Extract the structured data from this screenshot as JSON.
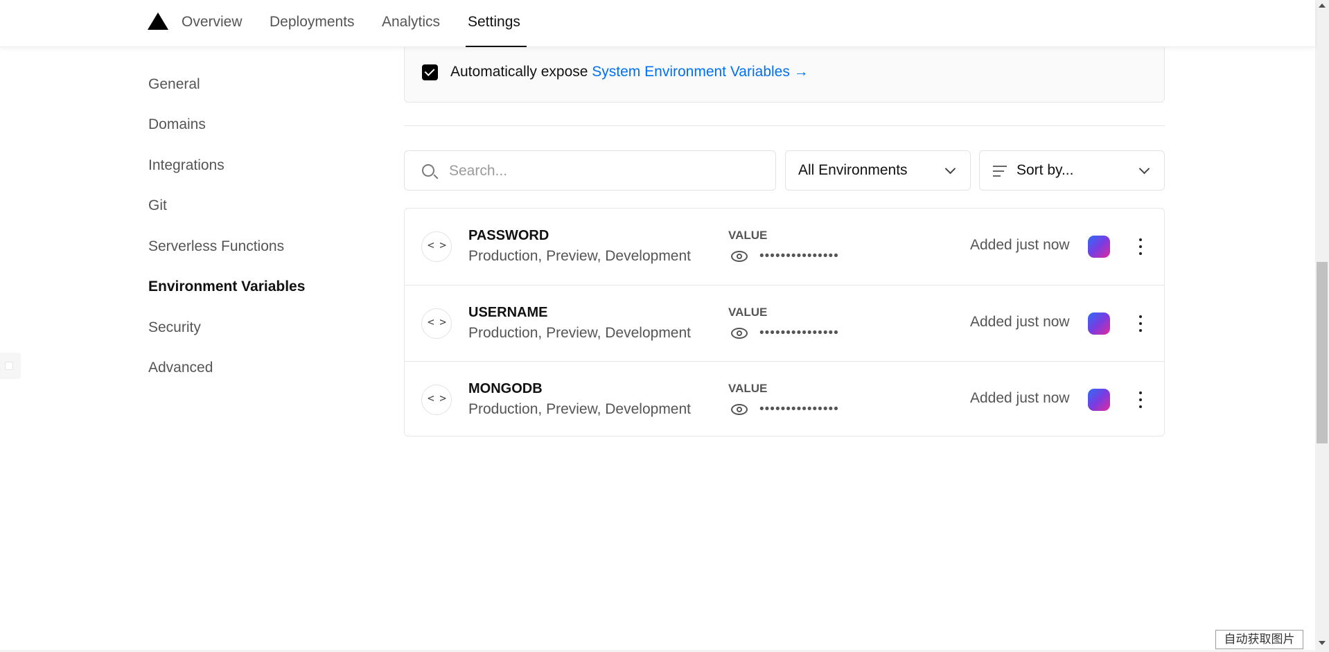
{
  "nav": {
    "tabs": [
      {
        "label": "Overview"
      },
      {
        "label": "Deployments"
      },
      {
        "label": "Analytics"
      },
      {
        "label": "Settings",
        "active": true
      }
    ]
  },
  "sidebar": {
    "items": [
      {
        "label": "General"
      },
      {
        "label": "Domains"
      },
      {
        "label": "Integrations"
      },
      {
        "label": "Git"
      },
      {
        "label": "Serverless Functions"
      },
      {
        "label": "Environment Variables",
        "active": true
      },
      {
        "label": "Security"
      },
      {
        "label": "Advanced"
      }
    ]
  },
  "expose": {
    "checked": true,
    "text": "Automatically expose ",
    "link": "System Environment Variables →"
  },
  "filters": {
    "search_placeholder": "Search...",
    "environment_select": "All Environments",
    "sort_select": "Sort by..."
  },
  "env_vars": [
    {
      "name": "PASSWORD",
      "scope": "Production, Preview, Development",
      "value_label": "VALUE",
      "masked_value": "•••••••••••••••",
      "added": "Added just now"
    },
    {
      "name": "USERNAME",
      "scope": "Production, Preview, Development",
      "value_label": "VALUE",
      "masked_value": "•••••••••••••••",
      "added": "Added just now"
    },
    {
      "name": "MONGODB",
      "scope": "Production, Preview, Development",
      "value_label": "VALUE",
      "masked_value": "•••••••••••••••",
      "added": "Added just now"
    }
  ],
  "bottom_button": "自动获取图片",
  "colors": {
    "accent_link": "#0070f3",
    "avatar_gradient": [
      "#2f6cf6",
      "#7a3ce0",
      "#e02a9c"
    ]
  },
  "icons": {
    "logo": "triangle-logo-icon",
    "search": "search-icon",
    "chevron": "chevron-down-icon",
    "sort": "sort-lines-icon",
    "code": "code-brackets-icon",
    "eye": "eye-icon",
    "more": "more-vertical-icon"
  }
}
